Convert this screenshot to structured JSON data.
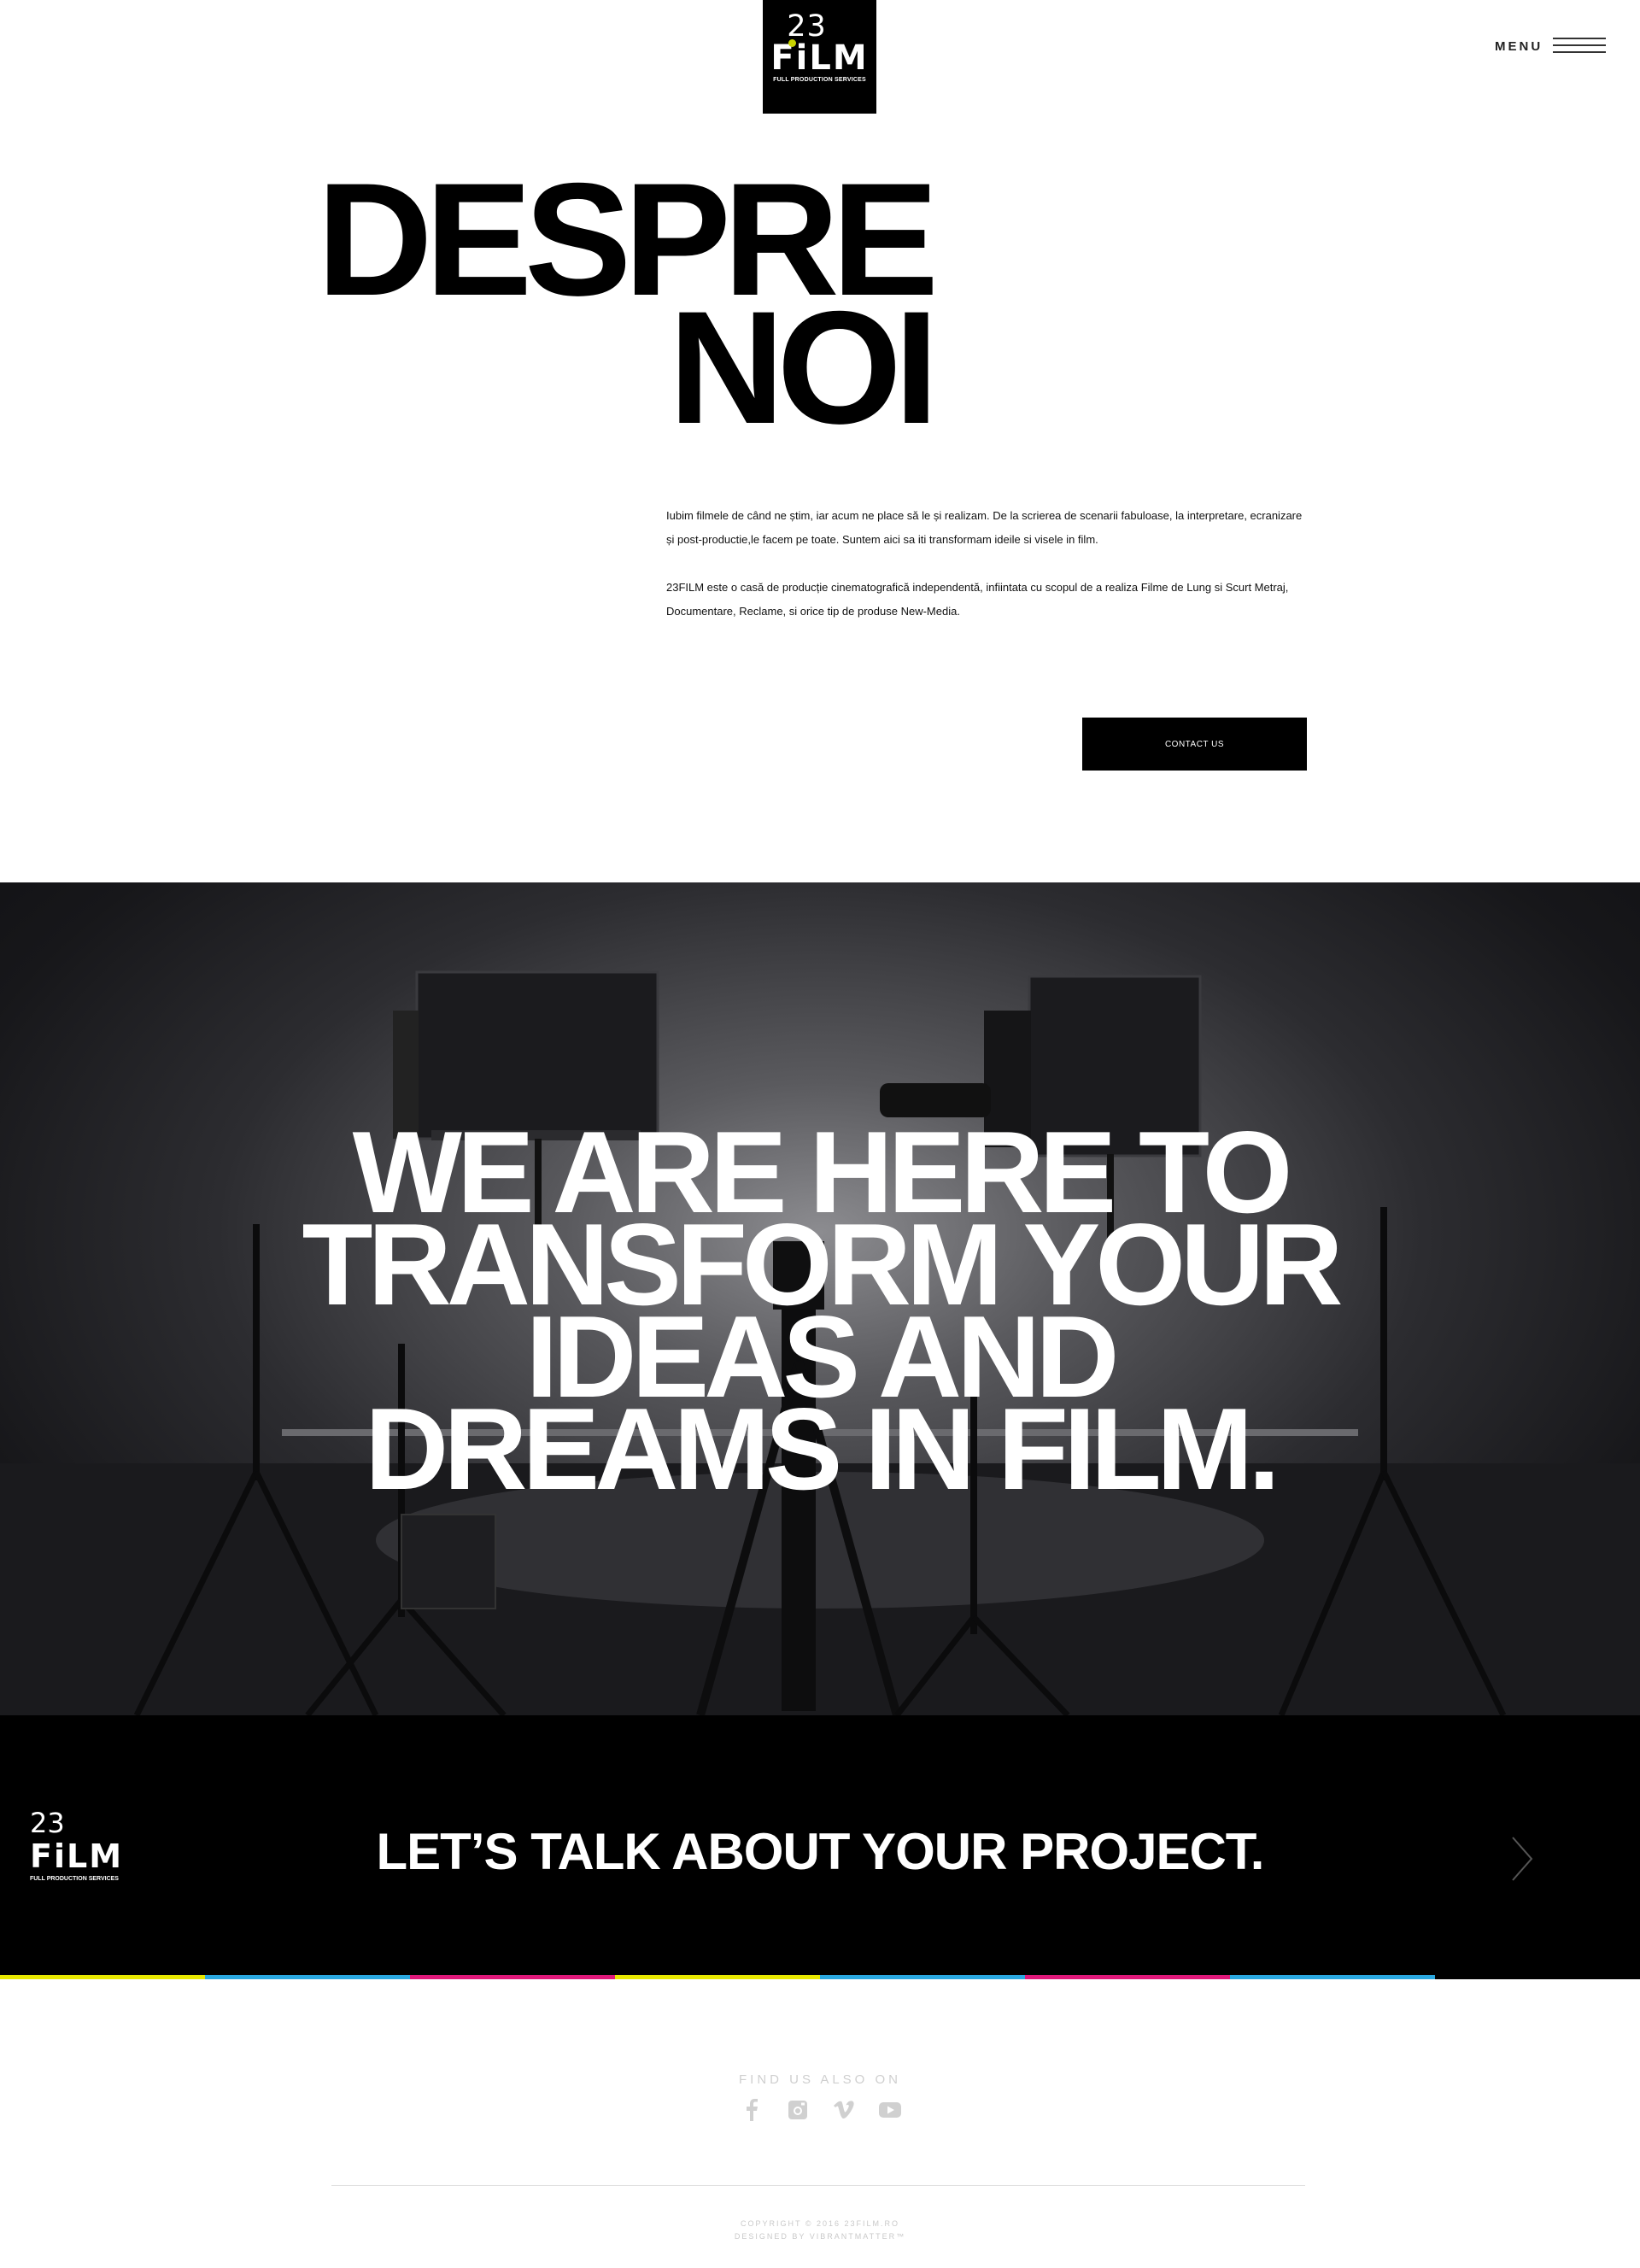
{
  "header": {
    "logo": {
      "number": "23",
      "name": "FiLM",
      "tagline": "FULL PRODUCTION SERVICES"
    },
    "menu_label": "MENU"
  },
  "about": {
    "title_line1": "DESPRE",
    "title_line2": "NOI",
    "paragraph1": "Iubim filmele de când ne știm, iar acum ne place să le și realizam. De la scrierea de scenarii fabuloase, la interpretare, ecranizare și post-productie,le facem pe toate. Suntem aici sa iti transformam ideile si visele in film.",
    "paragraph2": "23FILM este o casă de producție cinematografică independentă, infiintata cu scopul de a realiza Filme de Lung si Scurt Metraj, Documentare, Reclame, si orice tip de produse  New-Media.",
    "contact_button": "CONTACT US"
  },
  "hero": {
    "line1": "WE ARE HERE TO",
    "line2": "TRANSFORM YOUR",
    "line3": "IDEAS AND",
    "line4": "DREAMS IN FILM."
  },
  "cta": {
    "logo": {
      "number": "23",
      "name": "FiLM",
      "tagline": "FULL PRODUCTION SERVICES"
    },
    "text": "LET’S TALK ABOUT YOUR PROJECT.",
    "arrow_icon": "chevron-right-icon"
  },
  "color_bar": [
    "#e8e800",
    "#2aa8e0",
    "#e0187a",
    "#e8e800",
    "#2aa8e0",
    "#e0187a",
    "#2aa8e0",
    "#000000"
  ],
  "footer": {
    "find_label": "FIND US ALSO ON",
    "socials": [
      "facebook-icon",
      "instagram-icon",
      "vimeo-icon",
      "youtube-icon"
    ],
    "copyright": "COPYRIGHT © 2016  23FILM.RO",
    "designed_by": "DESIGNED BY VIBRANTMATTER™"
  }
}
